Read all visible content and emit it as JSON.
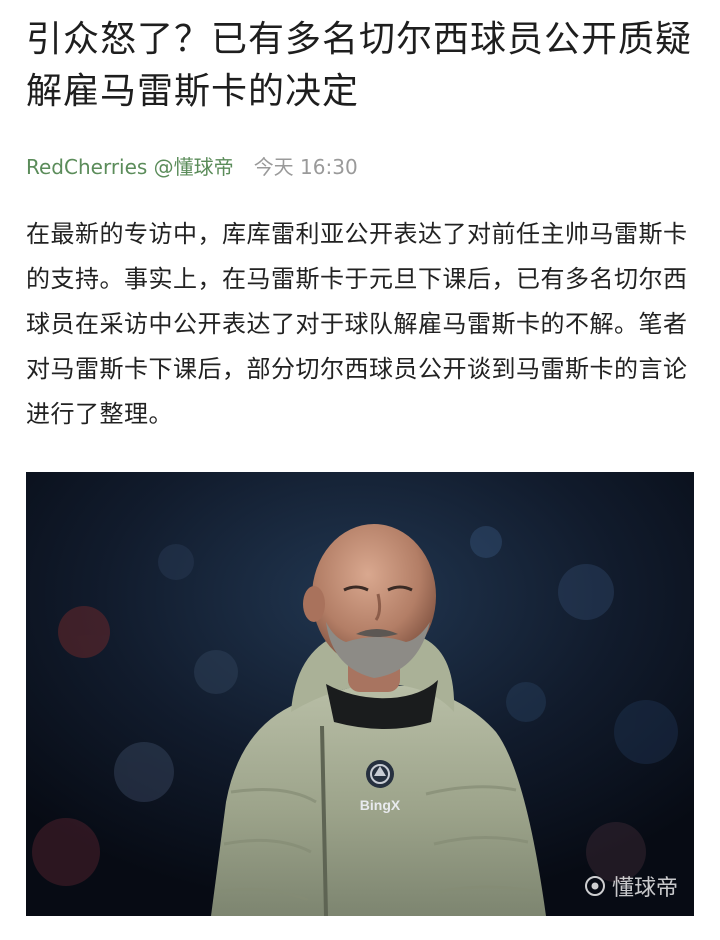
{
  "article": {
    "title": "引众怒了？已有多名切尔西球员公开质疑解雇马雷斯卡的决定",
    "author": "RedCherries @懂球帝",
    "time": "今天 16:30",
    "body": "在最新的专访中，库库雷利亚公开表达了对前任主帅马雷斯卡的支持。事实上，在马雷斯卡于元旦下课后，已有多名切尔西球员在采访中公开表达了对于球队解雇马雷斯卡的不解。笔者对马雷斯卡下课后，部分切尔西球员公开谈到马雷斯卡的言论进行了整理。"
  },
  "photo": {
    "jacket_text": "BingX",
    "watermark": "懂球帝",
    "watermark_icon": "dongqiudi-logo-icon"
  },
  "colors": {
    "author": "#5b8c5a",
    "time": "#9a9a9a",
    "title": "#1e1e1e",
    "body": "#222222"
  }
}
